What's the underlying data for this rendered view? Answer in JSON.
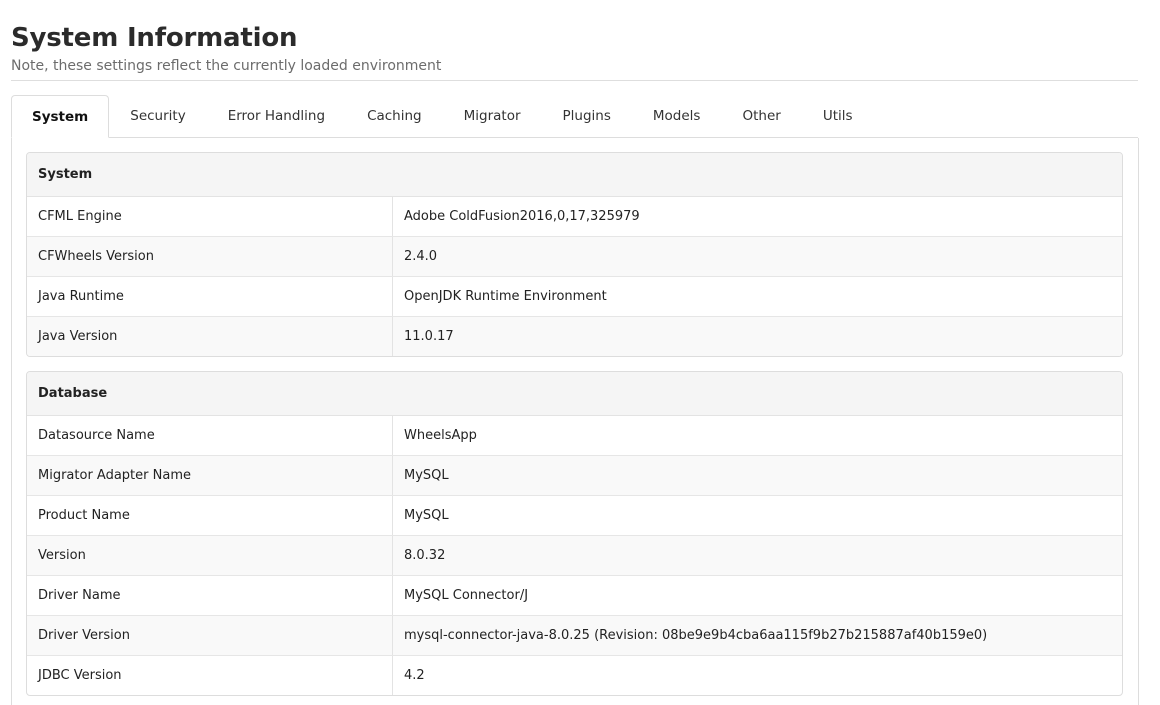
{
  "header": {
    "title": "System Information",
    "subtitle": "Note, these settings reflect the currently loaded environment"
  },
  "tabs": [
    {
      "label": "System",
      "active": true
    },
    {
      "label": "Security",
      "active": false
    },
    {
      "label": "Error Handling",
      "active": false
    },
    {
      "label": "Caching",
      "active": false
    },
    {
      "label": "Migrator",
      "active": false
    },
    {
      "label": "Plugins",
      "active": false
    },
    {
      "label": "Models",
      "active": false
    },
    {
      "label": "Other",
      "active": false
    },
    {
      "label": "Utils",
      "active": false
    }
  ],
  "system": {
    "heading": "System",
    "rows": [
      {
        "label": "CFML Engine",
        "value": "Adobe ColdFusion2016,0,17,325979"
      },
      {
        "label": "CFWheels Version",
        "value": "2.4.0"
      },
      {
        "label": "Java Runtime",
        "value": "OpenJDK Runtime Environment"
      },
      {
        "label": "Java Version",
        "value": "11.0.17"
      }
    ]
  },
  "database": {
    "heading": "Database",
    "rows": [
      {
        "label": "Datasource Name",
        "value": "WheelsApp"
      },
      {
        "label": "Migrator Adapter Name",
        "value": "MySQL"
      },
      {
        "label": "Product Name",
        "value": "MySQL"
      },
      {
        "label": "Version",
        "value": "8.0.32"
      },
      {
        "label": "Driver Name",
        "value": "MySQL Connector/J"
      },
      {
        "label": "Driver Version",
        "value": "mysql-connector-java-8.0.25 (Revision: 08be9e9b4cba6aa115f9b27b215887af40b159e0)"
      },
      {
        "label": "JDBC Version",
        "value": "4.2"
      }
    ]
  }
}
